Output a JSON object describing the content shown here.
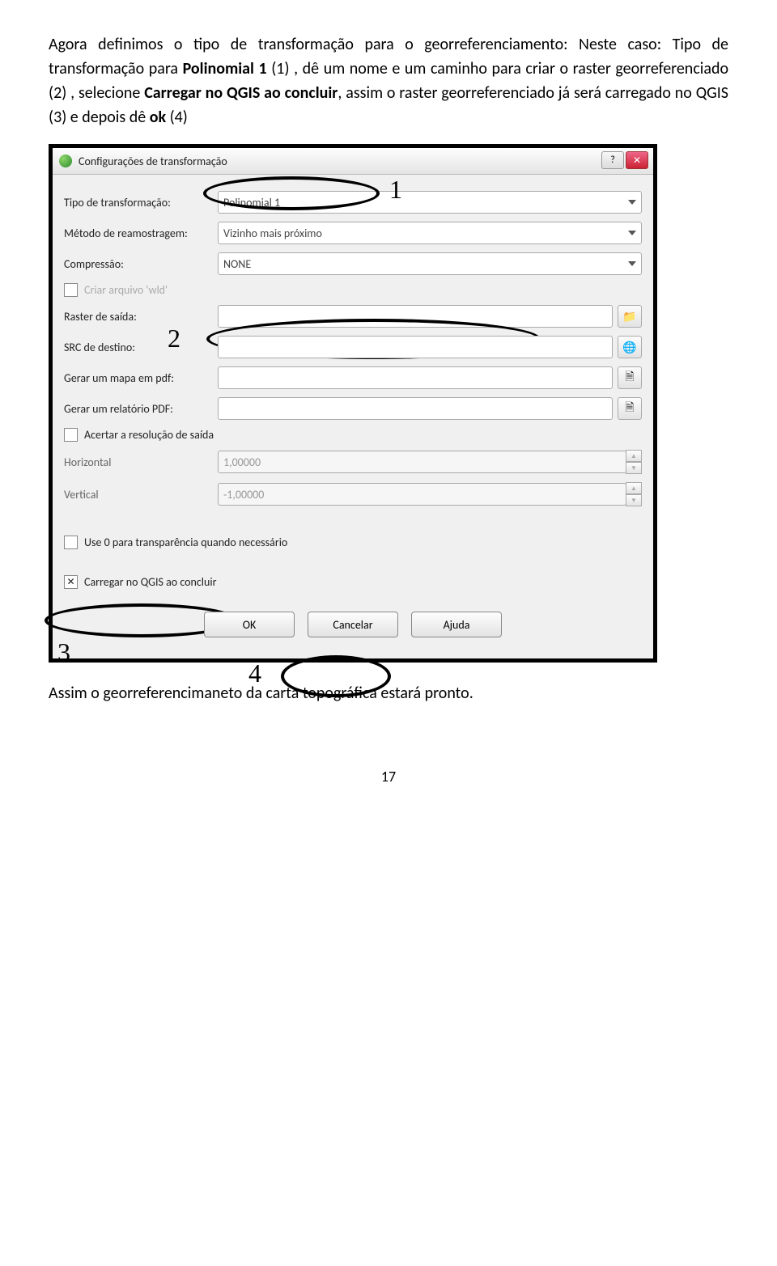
{
  "paragraph": {
    "seg1": "Agora definimos o tipo de transformação para o georreferenciamento: Neste caso: Tipo de transformação para ",
    "bold1": "Polinomial 1",
    "seg2": " (1) , dê um nome e um caminho para criar o raster georreferenciado (2) , selecione ",
    "bold2": "Carregar no QGIS ao concluir",
    "seg3": ", assim o raster georreferenciado já será carregado no QGIS (3) e depois dê ",
    "bold3": "ok",
    "seg4": " (4)"
  },
  "dialog": {
    "title": "Configurações de transformação",
    "labels": {
      "tipo": "Tipo de transformação:",
      "metodo": "Método de reamostragem:",
      "compressao": "Compressão:",
      "wld": "Criar arquivo 'wld'",
      "raster_saida": "Raster de saída:",
      "src": "SRC de destino:",
      "mapa_pdf": "Gerar um mapa em pdf:",
      "relatorio_pdf": "Gerar um relatório PDF:",
      "resolucao": "Acertar a resolução de saída",
      "horizontal": "Horizontal",
      "vertical": "Vertical",
      "transparencia": "Use 0 para transparência quando necessário",
      "carregar": "Carregar no QGIS ao concluir"
    },
    "values": {
      "tipo": "Polinomial 1",
      "metodo": "Vizinho mais próximo",
      "compressao": "NONE",
      "raster_saida": "",
      "src": "",
      "mapa_pdf": "",
      "relatorio_pdf": "",
      "horizontal": "1,00000",
      "vertical": "-1,00000"
    },
    "buttons": {
      "ok": "OK",
      "cancel": "Cancelar",
      "help": "Ajuda"
    }
  },
  "annotations": {
    "n1": "1",
    "n2": "2",
    "n3": "3",
    "n4": "4"
  },
  "after_text": "Assim o georreferencimaneto da carta topográfica estará pronto.",
  "page_number": "17"
}
